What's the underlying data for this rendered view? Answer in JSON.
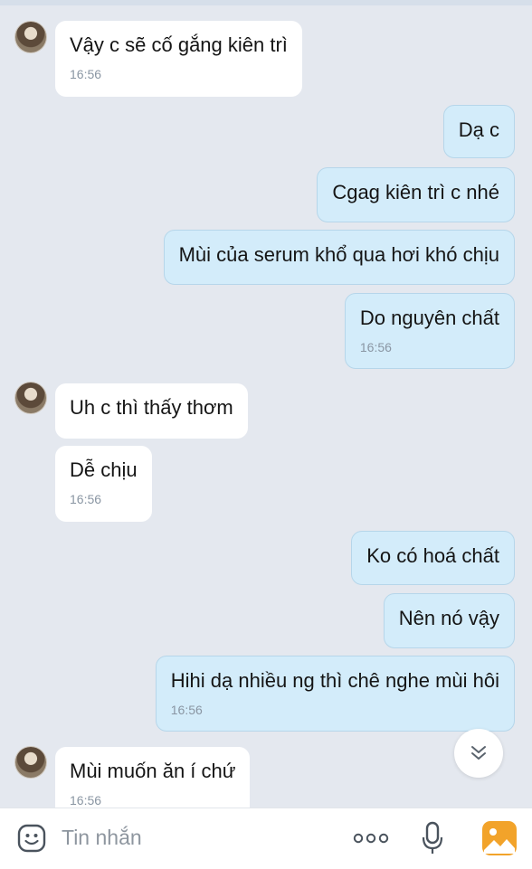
{
  "messages": [
    {
      "side": "in",
      "text": "Vậy c sẽ cố gắng kiên trì",
      "time": "16:56"
    },
    {
      "side": "out",
      "text": "Dạ c"
    },
    {
      "side": "out",
      "text": "Cgag kiên trì c nhé"
    },
    {
      "side": "out",
      "text": "Mùi của serum khổ qua hơi khó chịu"
    },
    {
      "side": "out",
      "text": "Do nguyên chất",
      "time": "16:56"
    },
    {
      "side": "in",
      "text": "Uh c thì thấy thơm"
    },
    {
      "side": "in",
      "text": "Dễ chịu",
      "time": "16:56"
    },
    {
      "side": "out",
      "text": "Ko có hoá chất"
    },
    {
      "side": "out",
      "text": "Nên nó vậy"
    },
    {
      "side": "out",
      "text": "Hihi dạ nhiều ng thì chê nghe mùi hôi",
      "time": "16:56"
    },
    {
      "side": "in",
      "text": "Mùi muốn ăn í chứ",
      "time": "16:56"
    }
  ],
  "input": {
    "placeholder": "Tin nhắn"
  },
  "icons": {
    "emoji": "emoji-icon",
    "more": "more-icon",
    "mic": "mic-icon",
    "image": "image-icon",
    "scroll": "double-chevron-down-icon"
  },
  "colors": {
    "background": "#e4e8ef",
    "incoming_bubble": "#ffffff",
    "outgoing_bubble": "#d3ecfa",
    "time_text": "#8a96a3"
  }
}
